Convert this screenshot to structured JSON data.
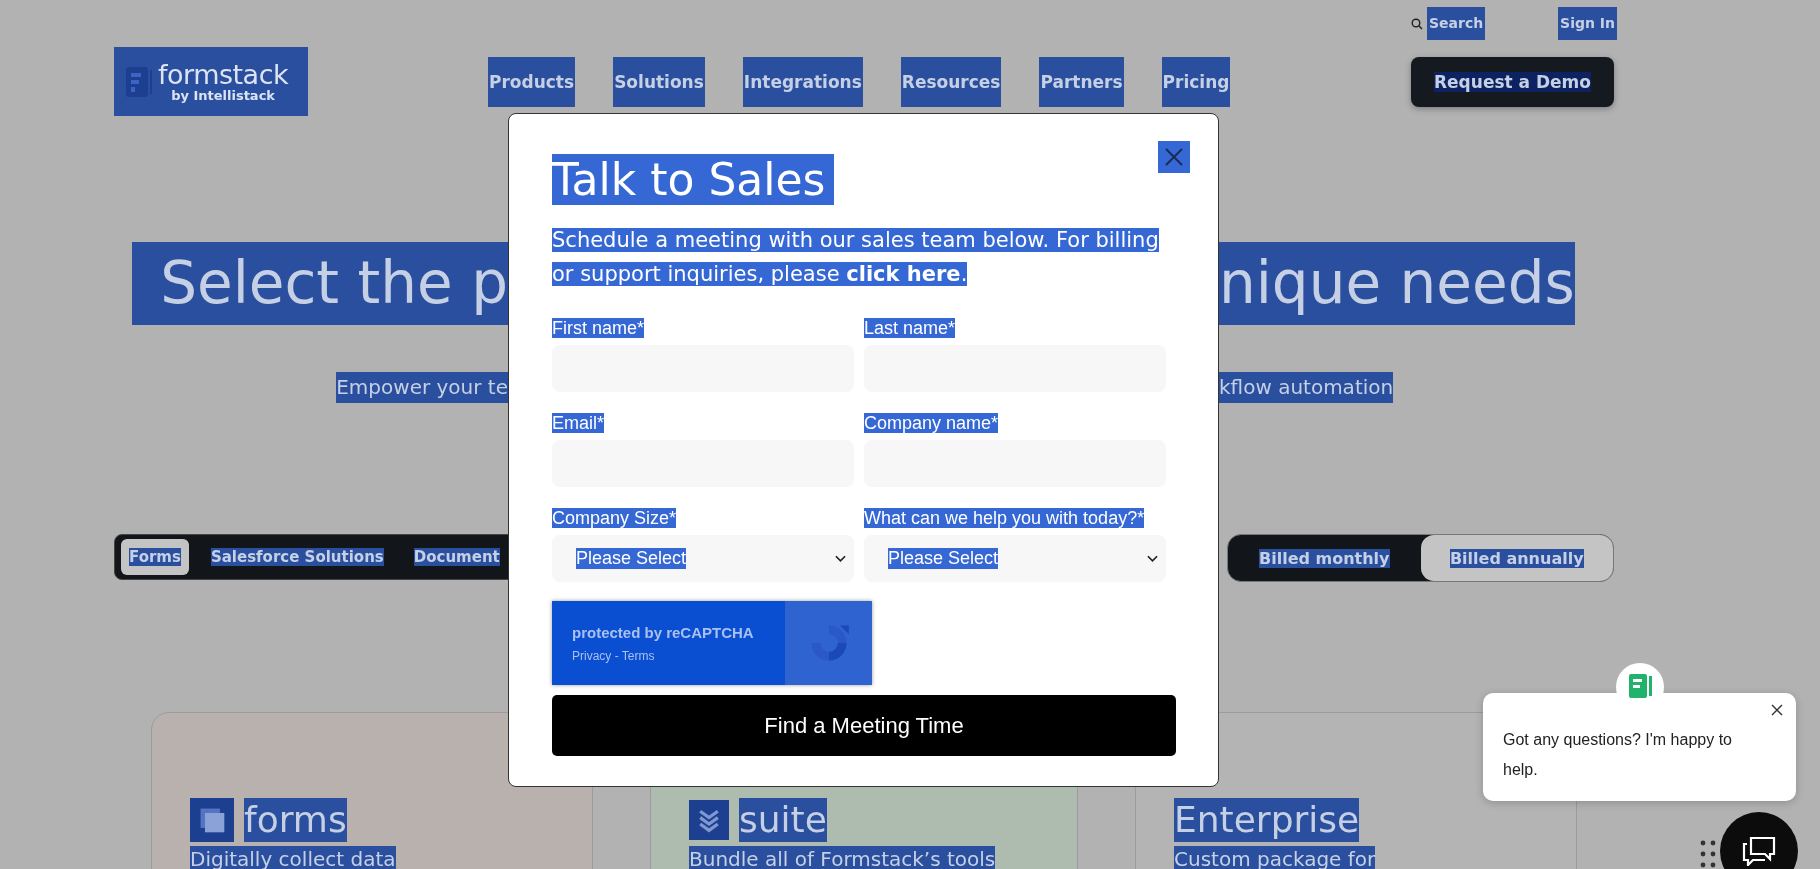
{
  "header": {
    "logo": {
      "name": "formstack",
      "tagline": "by Intellistack"
    },
    "utility_links": [
      {
        "label": "Search",
        "kind": "search"
      },
      {
        "label": "Sign In",
        "kind": "plain"
      }
    ],
    "nav": [
      "Products",
      "Solutions",
      "Integrations",
      "Resources",
      "Partners",
      "Pricing"
    ],
    "cta": "Request a Demo"
  },
  "hero": {
    "title_left": "Select the p",
    "title_right": "nique needs",
    "subtitle_left": "Empower your te",
    "subtitle_right": "kflow automation"
  },
  "product_tabs": [
    {
      "label": "Forms",
      "selected": true
    },
    {
      "label": "Salesforce Solutions",
      "selected": false
    },
    {
      "label": "Document",
      "selected": false
    }
  ],
  "billing": [
    {
      "label": "Billed monthly",
      "selected": false
    },
    {
      "label": "Billed annually",
      "selected": true
    }
  ],
  "plans": [
    {
      "name": "forms",
      "description": "Digitally collect data",
      "kind": "forms"
    },
    {
      "name": "suite",
      "description": "Bundle all of Formstack’s tools",
      "kind": "suite"
    },
    {
      "name": "Enterprise",
      "description": "Custom package for",
      "kind": "enterprise"
    }
  ],
  "modal": {
    "title": "Talk to Sales",
    "intro": "Schedule a meeting with our sales team below. For billing or support inquiries, please ",
    "intro_link": "click here",
    "intro_end": ".",
    "fields": [
      {
        "label": "First name*",
        "kind": "text"
      },
      {
        "label": "Last name*",
        "kind": "text"
      },
      {
        "label": "Email*",
        "kind": "text"
      },
      {
        "label": "Company name*",
        "kind": "text"
      },
      {
        "label": "Company Size*",
        "kind": "select",
        "value": "Please Select"
      },
      {
        "label": "What can we help you with today?*",
        "kind": "select",
        "value": "Please Select"
      }
    ],
    "recaptcha": {
      "text": "protected by reCAPTCHA",
      "links": "Privacy - Terms"
    },
    "submit": "Find a Meeting Time"
  },
  "chat": {
    "message": "Got any questions? I'm happy to help."
  }
}
